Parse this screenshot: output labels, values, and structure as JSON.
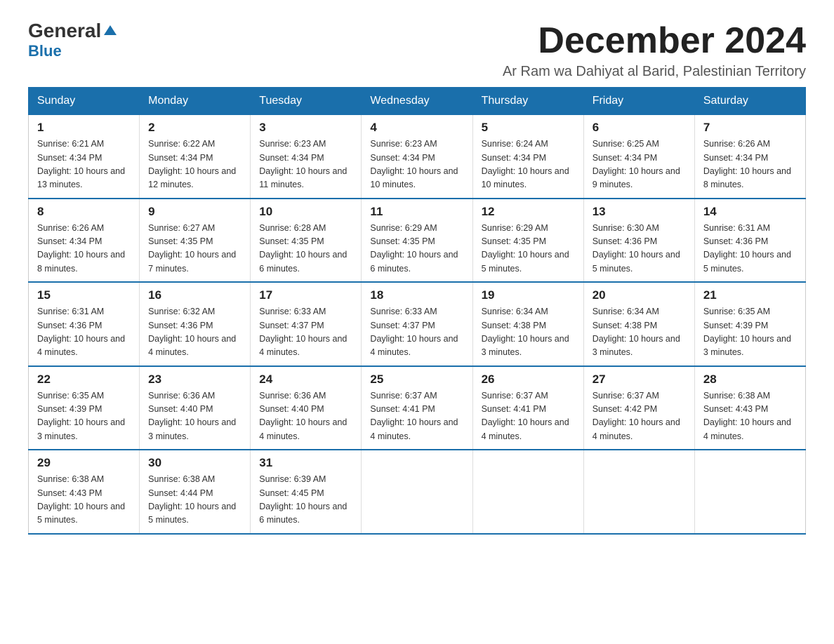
{
  "logo": {
    "text_general": "General",
    "text_blue": "Blue",
    "arrow": "▶"
  },
  "header": {
    "month_year": "December 2024",
    "location": "Ar Ram wa Dahiyat al Barid, Palestinian Territory"
  },
  "days_of_week": [
    "Sunday",
    "Monday",
    "Tuesday",
    "Wednesday",
    "Thursday",
    "Friday",
    "Saturday"
  ],
  "weeks": [
    [
      {
        "day": "1",
        "sunrise": "6:21 AM",
        "sunset": "4:34 PM",
        "daylight": "10 hours and 13 minutes."
      },
      {
        "day": "2",
        "sunrise": "6:22 AM",
        "sunset": "4:34 PM",
        "daylight": "10 hours and 12 minutes."
      },
      {
        "day": "3",
        "sunrise": "6:23 AM",
        "sunset": "4:34 PM",
        "daylight": "10 hours and 11 minutes."
      },
      {
        "day": "4",
        "sunrise": "6:23 AM",
        "sunset": "4:34 PM",
        "daylight": "10 hours and 10 minutes."
      },
      {
        "day": "5",
        "sunrise": "6:24 AM",
        "sunset": "4:34 PM",
        "daylight": "10 hours and 10 minutes."
      },
      {
        "day": "6",
        "sunrise": "6:25 AM",
        "sunset": "4:34 PM",
        "daylight": "10 hours and 9 minutes."
      },
      {
        "day": "7",
        "sunrise": "6:26 AM",
        "sunset": "4:34 PM",
        "daylight": "10 hours and 8 minutes."
      }
    ],
    [
      {
        "day": "8",
        "sunrise": "6:26 AM",
        "sunset": "4:34 PM",
        "daylight": "10 hours and 8 minutes."
      },
      {
        "day": "9",
        "sunrise": "6:27 AM",
        "sunset": "4:35 PM",
        "daylight": "10 hours and 7 minutes."
      },
      {
        "day": "10",
        "sunrise": "6:28 AM",
        "sunset": "4:35 PM",
        "daylight": "10 hours and 6 minutes."
      },
      {
        "day": "11",
        "sunrise": "6:29 AM",
        "sunset": "4:35 PM",
        "daylight": "10 hours and 6 minutes."
      },
      {
        "day": "12",
        "sunrise": "6:29 AM",
        "sunset": "4:35 PM",
        "daylight": "10 hours and 5 minutes."
      },
      {
        "day": "13",
        "sunrise": "6:30 AM",
        "sunset": "4:36 PM",
        "daylight": "10 hours and 5 minutes."
      },
      {
        "day": "14",
        "sunrise": "6:31 AM",
        "sunset": "4:36 PM",
        "daylight": "10 hours and 5 minutes."
      }
    ],
    [
      {
        "day": "15",
        "sunrise": "6:31 AM",
        "sunset": "4:36 PM",
        "daylight": "10 hours and 4 minutes."
      },
      {
        "day": "16",
        "sunrise": "6:32 AM",
        "sunset": "4:36 PM",
        "daylight": "10 hours and 4 minutes."
      },
      {
        "day": "17",
        "sunrise": "6:33 AM",
        "sunset": "4:37 PM",
        "daylight": "10 hours and 4 minutes."
      },
      {
        "day": "18",
        "sunrise": "6:33 AM",
        "sunset": "4:37 PM",
        "daylight": "10 hours and 4 minutes."
      },
      {
        "day": "19",
        "sunrise": "6:34 AM",
        "sunset": "4:38 PM",
        "daylight": "10 hours and 3 minutes."
      },
      {
        "day": "20",
        "sunrise": "6:34 AM",
        "sunset": "4:38 PM",
        "daylight": "10 hours and 3 minutes."
      },
      {
        "day": "21",
        "sunrise": "6:35 AM",
        "sunset": "4:39 PM",
        "daylight": "10 hours and 3 minutes."
      }
    ],
    [
      {
        "day": "22",
        "sunrise": "6:35 AM",
        "sunset": "4:39 PM",
        "daylight": "10 hours and 3 minutes."
      },
      {
        "day": "23",
        "sunrise": "6:36 AM",
        "sunset": "4:40 PM",
        "daylight": "10 hours and 3 minutes."
      },
      {
        "day": "24",
        "sunrise": "6:36 AM",
        "sunset": "4:40 PM",
        "daylight": "10 hours and 4 minutes."
      },
      {
        "day": "25",
        "sunrise": "6:37 AM",
        "sunset": "4:41 PM",
        "daylight": "10 hours and 4 minutes."
      },
      {
        "day": "26",
        "sunrise": "6:37 AM",
        "sunset": "4:41 PM",
        "daylight": "10 hours and 4 minutes."
      },
      {
        "day": "27",
        "sunrise": "6:37 AM",
        "sunset": "4:42 PM",
        "daylight": "10 hours and 4 minutes."
      },
      {
        "day": "28",
        "sunrise": "6:38 AM",
        "sunset": "4:43 PM",
        "daylight": "10 hours and 4 minutes."
      }
    ],
    [
      {
        "day": "29",
        "sunrise": "6:38 AM",
        "sunset": "4:43 PM",
        "daylight": "10 hours and 5 minutes."
      },
      {
        "day": "30",
        "sunrise": "6:38 AM",
        "sunset": "4:44 PM",
        "daylight": "10 hours and 5 minutes."
      },
      {
        "day": "31",
        "sunrise": "6:39 AM",
        "sunset": "4:45 PM",
        "daylight": "10 hours and 6 minutes."
      },
      null,
      null,
      null,
      null
    ]
  ]
}
